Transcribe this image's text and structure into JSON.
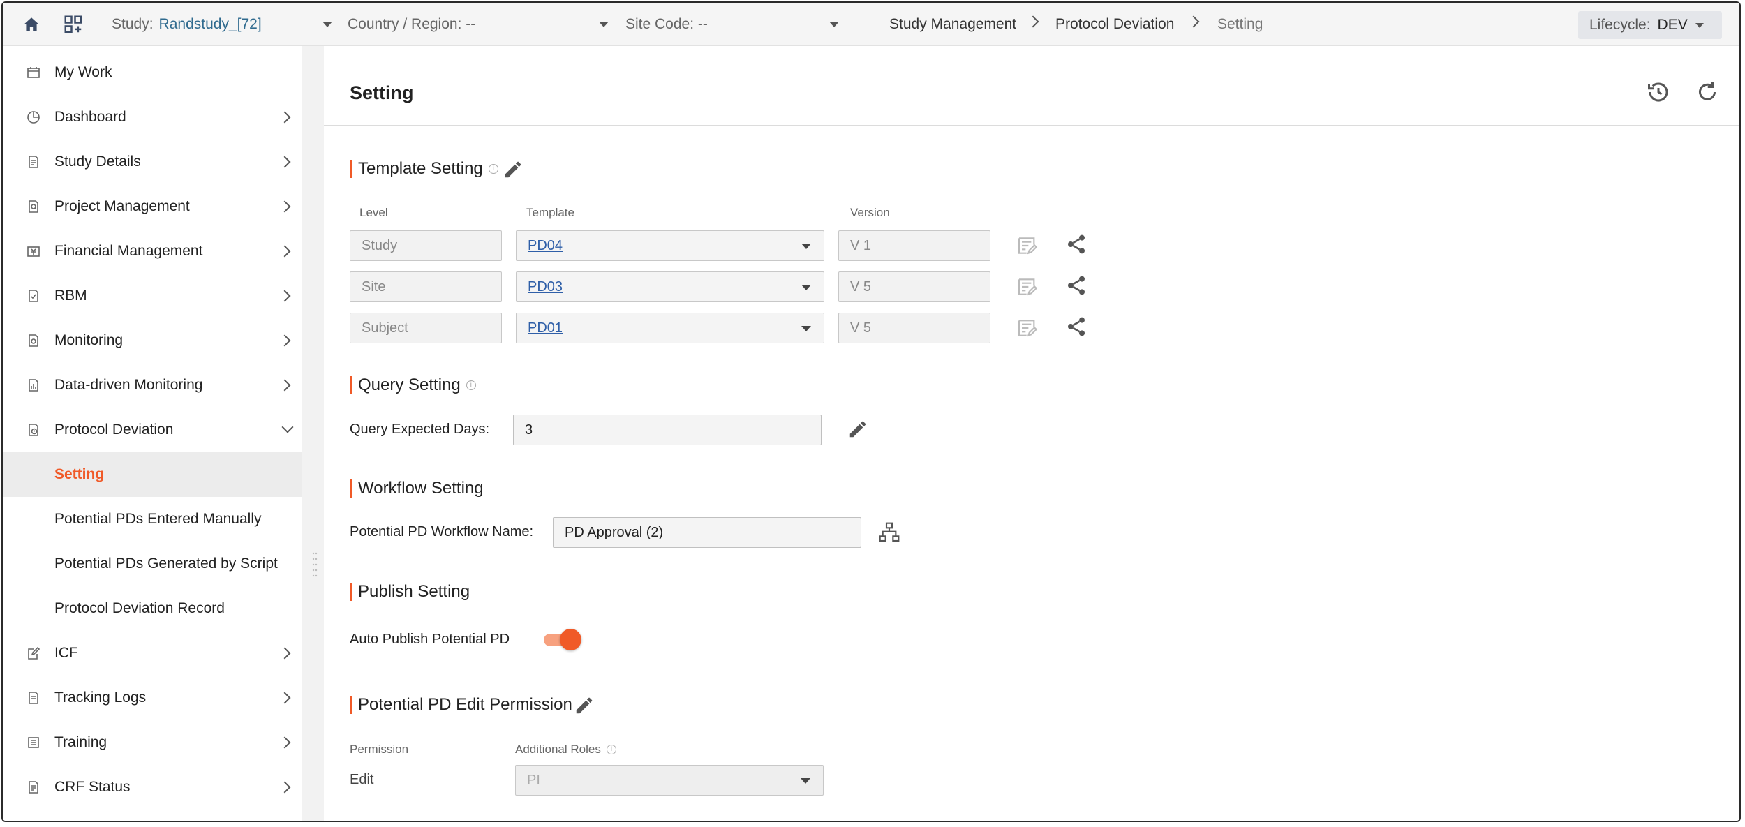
{
  "topbar": {
    "study_label": "Study:",
    "study_value": "Randstudy_[72]",
    "country_label": "Country / Region: --",
    "site_label": "Site Code: --",
    "breadcrumbs": [
      "Study Management",
      "Protocol Deviation",
      "Setting"
    ],
    "lifecycle_label": "Lifecycle:",
    "lifecycle_value": "DEV"
  },
  "sidebar": {
    "items": [
      {
        "label": "My Work",
        "icon": "calendar-icon"
      },
      {
        "label": "Dashboard",
        "icon": "pie-chart-icon"
      },
      {
        "label": "Study Details",
        "icon": "document-icon"
      },
      {
        "label": "Project Management",
        "icon": "document-search-icon"
      },
      {
        "label": "Financial Management",
        "icon": "currency-icon"
      },
      {
        "label": "RBM",
        "icon": "document-check-icon"
      },
      {
        "label": "Monitoring",
        "icon": "document-icon"
      },
      {
        "label": "Data-driven Monitoring",
        "icon": "document-chart-icon"
      },
      {
        "label": "Protocol Deviation",
        "icon": "document-alert-icon"
      },
      {
        "label": "Setting"
      },
      {
        "label": "Potential PDs Entered Manually"
      },
      {
        "label": "Potential PDs Generated by Script"
      },
      {
        "label": "Protocol Deviation Record"
      },
      {
        "label": "ICF",
        "icon": "edit-document-icon"
      },
      {
        "label": "Tracking Logs",
        "icon": "document-icon"
      },
      {
        "label": "Training",
        "icon": "list-icon"
      },
      {
        "label": "CRF Status",
        "icon": "document-icon"
      }
    ]
  },
  "page": {
    "title": "Setting"
  },
  "template_setting": {
    "title": "Template Setting",
    "headers": {
      "level": "Level",
      "template": "Template",
      "version": "Version"
    },
    "rows": [
      {
        "level": "Study",
        "template": "PD04",
        "version": "V 1"
      },
      {
        "level": "Site",
        "template": "PD03",
        "version": "V 5"
      },
      {
        "level": "Subject",
        "template": "PD01",
        "version": "V 5"
      }
    ]
  },
  "query_setting": {
    "title": "Query Setting",
    "label": "Query Expected Days:",
    "value": "3"
  },
  "workflow_setting": {
    "title": "Workflow Setting",
    "label": "Potential PD Workflow Name:",
    "value": "PD Approval (2)"
  },
  "publish_setting": {
    "title": "Publish Setting",
    "label": "Auto Publish Potential PD",
    "enabled": true
  },
  "edit_permission": {
    "title": "Potential PD Edit Permission",
    "permission_header": "Permission",
    "roles_header": "Additional Roles",
    "permission_value": "Edit",
    "roles_value": "PI"
  },
  "colors": {
    "accent": "#f05a28",
    "link": "#2f5fa8",
    "study_value": "#2f6a8e"
  }
}
